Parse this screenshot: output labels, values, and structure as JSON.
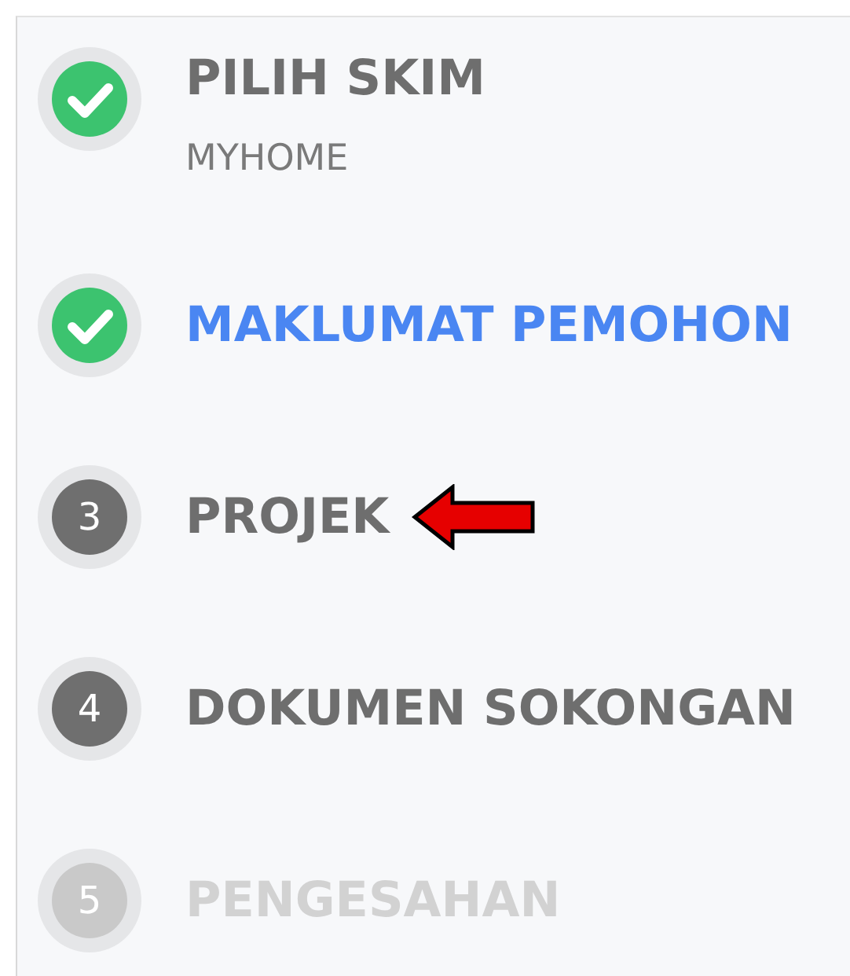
{
  "steps": [
    {
      "kind": "check",
      "label": "PILIH SKIM",
      "subtitle": "MYHOME",
      "disabled": false,
      "selected": false,
      "pointed": false
    },
    {
      "kind": "check",
      "label": "MAKLUMAT PEMOHON",
      "disabled": false,
      "selected": true,
      "pointed": false
    },
    {
      "kind": "number",
      "number": "3",
      "label": "PROJEK",
      "disabled": false,
      "selected": false,
      "pointed": true
    },
    {
      "kind": "number",
      "number": "4",
      "label": "DOKUMEN SOKONGAN",
      "disabled": false,
      "selected": false,
      "pointed": false
    },
    {
      "kind": "number",
      "number": "5",
      "label": "PENGESAHAN",
      "disabled": true,
      "selected": false,
      "pointed": false
    }
  ]
}
